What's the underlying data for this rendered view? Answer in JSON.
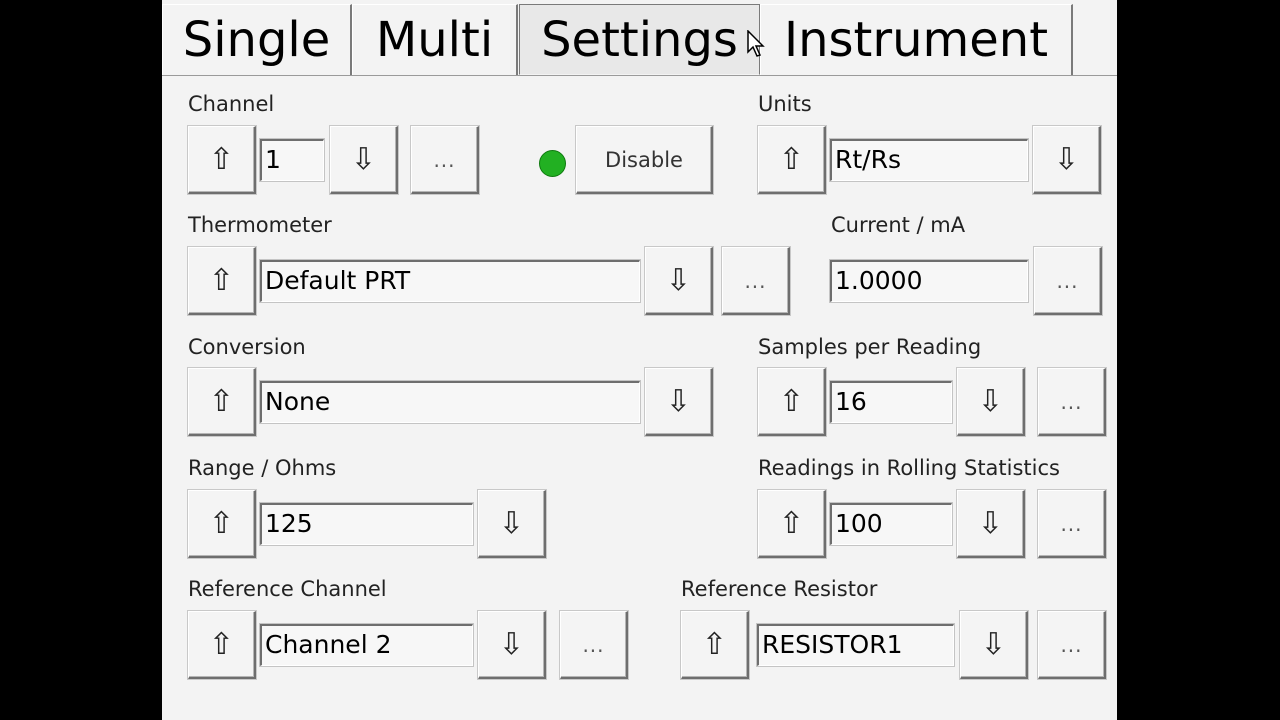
{
  "tabs": [
    {
      "label": "Single"
    },
    {
      "label": "Multi"
    },
    {
      "label": "Settings",
      "active": true
    },
    {
      "label": "Instrument"
    }
  ],
  "icons": {
    "up": "⇧",
    "down": "⇩",
    "more": "..."
  },
  "channel": {
    "label": "Channel",
    "value": "1"
  },
  "enable": {
    "button": "Disable",
    "status_color": "#22b022"
  },
  "units": {
    "label": "Units",
    "value": "Rt/Rs"
  },
  "thermometer": {
    "label": "Thermometer",
    "value": "Default PRT"
  },
  "current": {
    "label": "Current / mA",
    "value": "1.0000"
  },
  "conversion": {
    "label": "Conversion",
    "value": "None"
  },
  "samples": {
    "label": "Samples per Reading",
    "value": "16"
  },
  "range": {
    "label": "Range / Ohms",
    "value": "125"
  },
  "rolling": {
    "label": "Readings in Rolling Statistics",
    "value": "100"
  },
  "ref_channel": {
    "label": "Reference Channel",
    "value": "Channel 2"
  },
  "ref_resistor": {
    "label": "Reference Resistor",
    "value": "RESISTOR1"
  }
}
